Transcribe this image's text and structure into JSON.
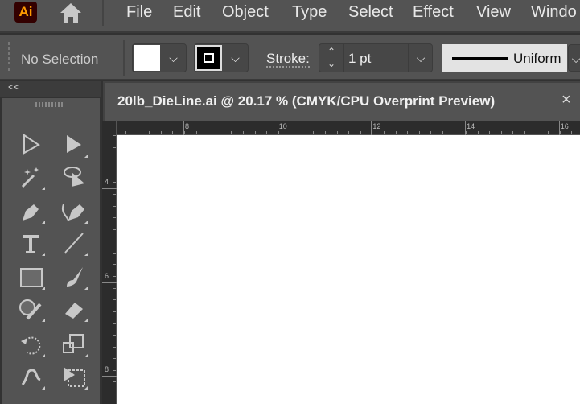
{
  "app": {
    "logo": "Ai",
    "home_icon": "home-icon"
  },
  "menu": [
    "File",
    "Edit",
    "Object",
    "Type",
    "Select",
    "Effect",
    "View",
    "Windo"
  ],
  "control": {
    "selection": "No Selection",
    "fill_color": "#ffffff",
    "stroke_color": "#000000",
    "stroke_label": "Stroke:",
    "stroke_weight": "1 pt",
    "profile": "Uniform"
  },
  "panel": {
    "collapse": "<<"
  },
  "document": {
    "title": "20lb_DieLine.ai @ 20.17 % (CMYK/CPU Overprint Preview)",
    "close": "×"
  },
  "rulers": {
    "horizontal": [
      "8",
      "10",
      "12",
      "14",
      "16"
    ],
    "vertical": [
      "4",
      "6",
      "8"
    ]
  },
  "tools": [
    "selection",
    "direct-selection",
    "magic-wand",
    "lasso",
    "pen",
    "curvature",
    "type",
    "line-segment",
    "rectangle",
    "paintbrush",
    "shaper",
    "eraser",
    "rotate",
    "scale",
    "puppet-warp",
    "free-transform"
  ]
}
